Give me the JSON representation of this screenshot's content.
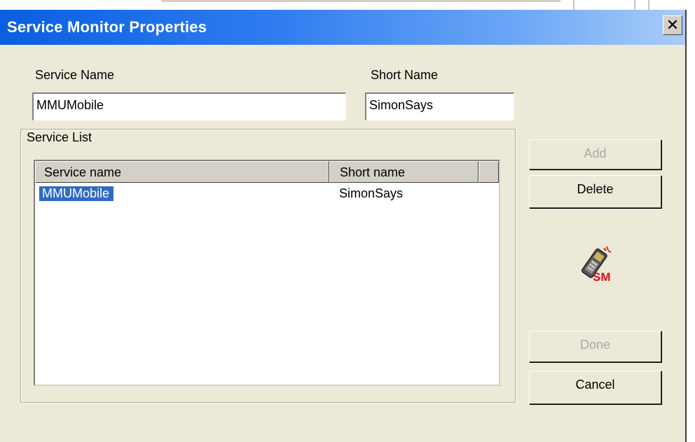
{
  "window": {
    "title": "Service Monitor Properties",
    "close_glyph": "✕"
  },
  "form": {
    "service_name_label": "Service Name",
    "service_name_value": "MMUMobile",
    "short_name_label": "Short Name",
    "short_name_value": "SimonSays"
  },
  "service_list": {
    "group_label": "Service List",
    "columns": [
      "Service name",
      "Short name"
    ],
    "rows": [
      {
        "service_name": "MMUMobile",
        "short_name": "SimonSays",
        "selected": true
      }
    ]
  },
  "buttons": {
    "add": "Add",
    "delete": "Delete",
    "done": "Done",
    "cancel": "Cancel"
  },
  "logo": {
    "icon": "mobile-phone-icon",
    "text": "SM",
    "text_color": "#dd1010"
  },
  "colors": {
    "title_start": "#0a5fe0",
    "title_end": "#a9cdf8",
    "selection": "#316ac5",
    "dialog_bg": "#ece9d8"
  }
}
